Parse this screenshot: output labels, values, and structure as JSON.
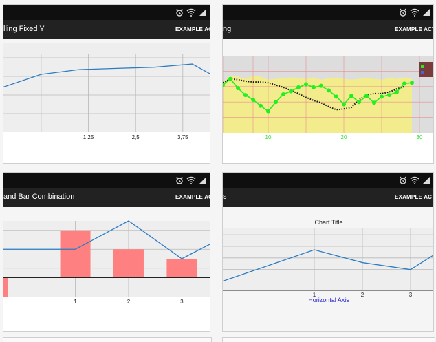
{
  "screens": [
    {
      "title": "lling Fixed Y",
      "action": "EXAMPLE ACTI",
      "chart_data": {
        "type": "line",
        "x": [
          -1.0,
          0.0,
          1.0,
          2.0,
          3.0,
          4.0,
          4.5
        ],
        "series": [
          {
            "values": [
              3.4,
              5.0,
              5.6,
              5.75,
              5.9,
              6.3,
              5.0
            ]
          }
        ],
        "x_ticks": [
          "1,25",
          "2,5",
          "3,75"
        ],
        "x_tick_values": [
          1.25,
          2.5,
          3.75
        ],
        "xlim": [
          -1.0,
          4.5
        ],
        "ylim": [
          -2.3,
          9.0
        ],
        "baseline_y": 2.0,
        "grid": true,
        "line_color": "#2b7cc4"
      }
    },
    {
      "title": "ng",
      "action": "EXAMPLE ACTION",
      "chart_data": {
        "type": "line",
        "x_ticks": [
          "10",
          "20",
          "30"
        ],
        "x_tick_values": [
          10,
          20,
          30
        ],
        "xlim": [
          4,
          32
        ],
        "ylim": [
          0,
          10
        ],
        "legend": "top-right",
        "series": [
          {
            "kind": "line-markers",
            "color": "#22ee22",
            "x": [
              4,
              5,
              6,
              7,
              8,
              9,
              10,
              11,
              12,
              13,
              14,
              15,
              16,
              17,
              18,
              19,
              20,
              21,
              22,
              23,
              24,
              25,
              26,
              27,
              28,
              29
            ],
            "values": [
              6.2,
              7.0,
              5.8,
              4.9,
              4.3,
              3.5,
              2.8,
              4.0,
              5.0,
              5.4,
              5.9,
              6.3,
              5.9,
              6.1,
              5.5,
              4.7,
              3.7,
              4.8,
              4.0,
              4.8,
              3.9,
              4.7,
              4.9,
              5.3,
              6.4,
              6.5
            ]
          },
          {
            "kind": "dotted",
            "color": "#111111",
            "x": [
              4,
              5,
              6,
              7,
              8,
              9,
              10,
              11,
              12,
              13,
              14,
              15,
              16,
              17,
              18,
              19,
              20,
              21,
              22,
              23,
              24,
              25,
              26,
              27,
              28
            ],
            "values": [
              6.5,
              7.0,
              6.9,
              6.7,
              6.6,
              6.6,
              6.5,
              6.2,
              5.9,
              5.5,
              5.1,
              4.6,
              4.2,
              3.9,
              3.4,
              3.0,
              3.1,
              3.3,
              4.3,
              4.9,
              5.1,
              5.1,
              5.3,
              5.7,
              6.0
            ]
          },
          {
            "kind": "area",
            "color": "#f2ec8c",
            "x": [
              4,
              5,
              6,
              7,
              8,
              9,
              10,
              11,
              12,
              13,
              14,
              15,
              16,
              17,
              18,
              19,
              20,
              21,
              22,
              23,
              24,
              25,
              26,
              27,
              28,
              29
            ],
            "values": [
              6.6,
              7.4,
              7.3,
              7.0,
              7.4,
              7.3,
              6.9,
              7.0,
              7.1,
              7.2,
              7.1,
              7.0,
              7.2,
              6.9,
              7.1,
              7.2,
              7.0,
              6.9,
              7.0,
              7.1,
              7.0,
              6.9,
              7.1,
              7.0,
              7.2,
              7.1
            ]
          }
        ]
      }
    },
    {
      "title": "and Bar Combination",
      "action": "EXAMPLE ACTI",
      "chart_data": {
        "type": "bar",
        "x_ticks": [
          "1",
          "2",
          "3"
        ],
        "x_tick_values": [
          1,
          2,
          3
        ],
        "xlim": [
          -0.35,
          3.55
        ],
        "ylim": [
          -1.0,
          3.0
        ],
        "bars": {
          "color": "#ff8080",
          "x": [
            -0.35,
            1.0,
            2.0,
            3.0
          ],
          "values": [
            -1.0,
            2.5,
            1.5,
            1.0
          ]
        },
        "line": {
          "color": "#2b7cc4",
          "x": [
            -0.35,
            1.0,
            2.0,
            3.0,
            3.55
          ],
          "values": [
            1.5,
            1.5,
            3.0,
            1.0,
            1.8
          ]
        }
      }
    },
    {
      "title": "s",
      "action": "EXAMPLE ACTION",
      "chart_data": {
        "type": "line",
        "title": "Chart Title",
        "xlabel": "Horizontal Axis",
        "x_ticks": [
          "1",
          "2",
          "3"
        ],
        "x_tick_values": [
          1,
          2,
          3
        ],
        "xlim": [
          -0.9,
          3.5
        ],
        "ylim": [
          -0.8,
          4.6
        ],
        "series": [
          {
            "color": "#2b7cc4",
            "x": [
              -0.9,
              1.0,
              2.0,
              3.0,
              3.5
            ],
            "values": [
              0.0,
              2.7,
              1.6,
              1.0,
              2.3
            ]
          }
        ]
      }
    }
  ],
  "colors": {
    "status_bar": "#0f0f0f",
    "app_bar": "#222222",
    "chart_bg": "#eeeeee",
    "grid": "#b8b8b8",
    "plot2_bg": "#dddddd",
    "plot2_grid": "#e89090",
    "plot2_tick": "#33dd33",
    "title_link": "#2222cc"
  },
  "icons": {
    "alarm": "alarm-clock-icon",
    "wifi": "wifi-icon",
    "signal": "signal-icon"
  }
}
